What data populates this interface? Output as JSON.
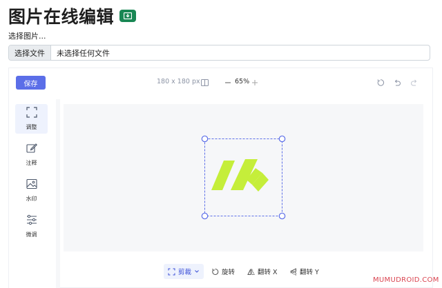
{
  "page": {
    "title": "图片在线编辑",
    "choose_label": "选择图片..."
  },
  "file_input": {
    "button_label": "选择文件",
    "status_text": "未选择任何文件"
  },
  "toolbar": {
    "save_label": "保存",
    "image_size": "180 x 180 px",
    "zoom_level": "65%",
    "icons": [
      "compare-icon",
      "zoom-out-icon",
      "zoom-in-icon",
      "reset-icon",
      "undo-icon",
      "redo-icon"
    ]
  },
  "sidebar": {
    "items": [
      {
        "label": "调整",
        "icon": "crop-frame-icon",
        "active": true
      },
      {
        "label": "注释",
        "icon": "annotate-pen-icon",
        "active": false
      },
      {
        "label": "水印",
        "icon": "watermark-image-icon",
        "active": false
      },
      {
        "label": "微调",
        "icon": "sliders-icon",
        "active": false
      }
    ]
  },
  "bottom_tools": {
    "items": [
      {
        "label": "剪裁",
        "icon": "crop-icon",
        "active": true,
        "has_dropdown": true
      },
      {
        "label": "旋转",
        "icon": "rotate-icon",
        "active": false
      },
      {
        "label": "翻转 X",
        "icon": "flip-x-icon",
        "active": false
      },
      {
        "label": "翻转 Y",
        "icon": "flip-y-icon",
        "active": false
      }
    ]
  },
  "colors": {
    "accent": "#5b6ee8",
    "title_badge": "#198754",
    "logo_green": "#c5ee3a",
    "crop_handle": "#5b6ee8",
    "watermark": "#d9434f"
  },
  "watermark": "MUMUDROID.COM"
}
